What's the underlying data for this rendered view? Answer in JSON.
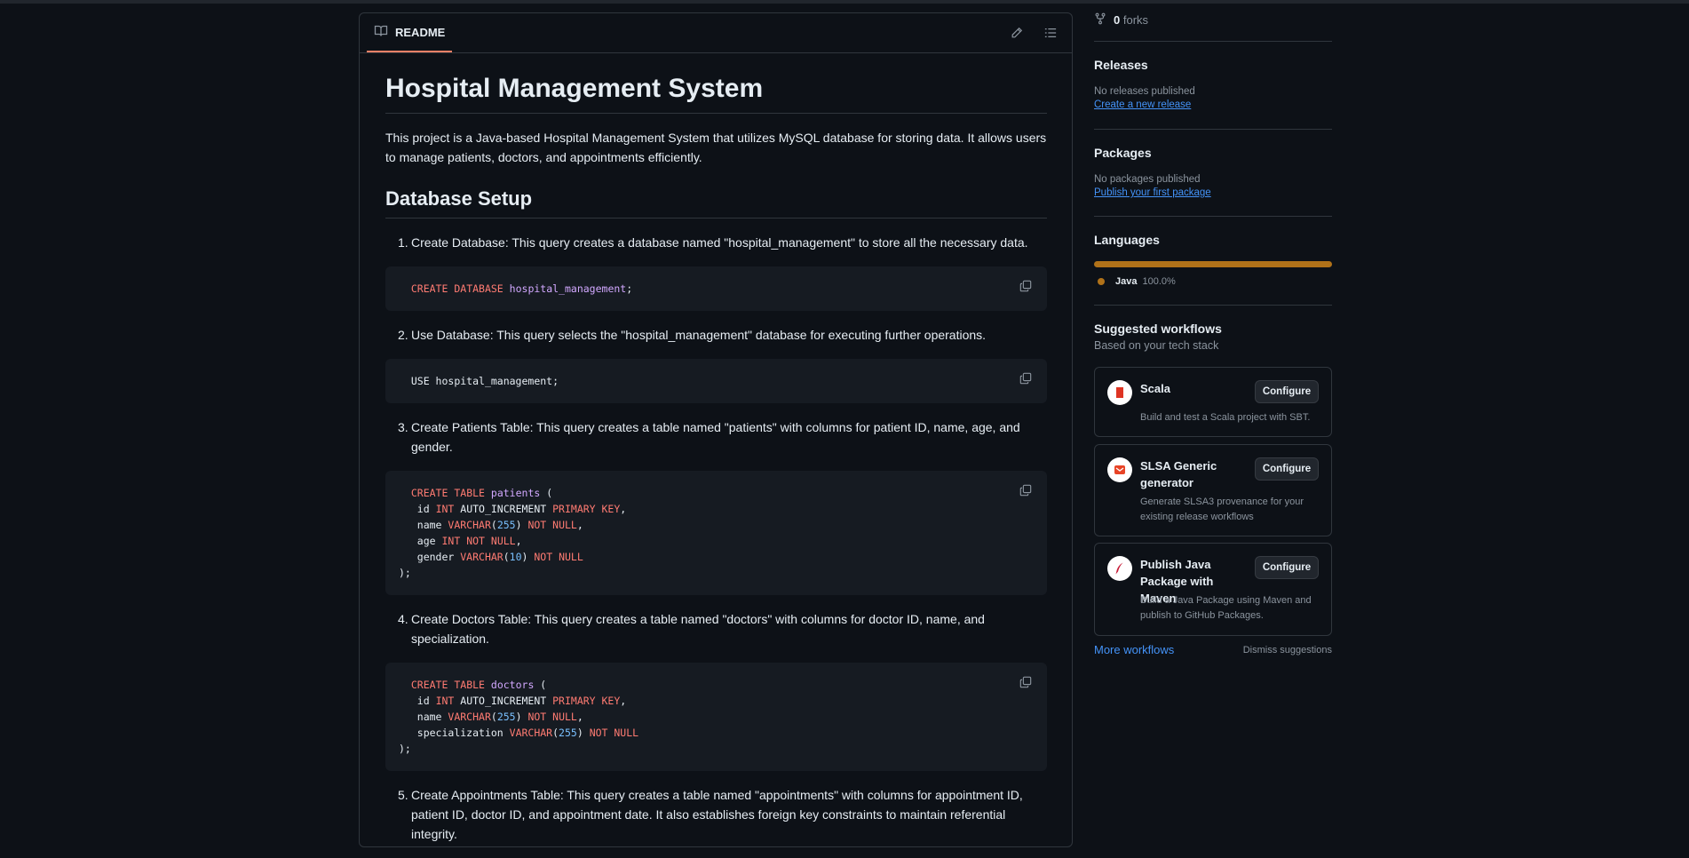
{
  "readme": {
    "tab_label": "README",
    "title": "Hospital Management System",
    "intro": "This project is a Java-based Hospital Management System that utilizes MySQL database for storing data. It allows users to manage patients, doctors, and appointments efficiently.",
    "section_heading": "Database Setup",
    "steps": [
      {
        "num": "1.",
        "text": "Create Database: This query creates a database named \"hospital_management\" to store all the necessary data."
      },
      {
        "num": "2.",
        "text": "Use Database: This query selects the \"hospital_management\" database for executing further operations."
      },
      {
        "num": "3.",
        "text": "Create Patients Table: This query creates a table named \"patients\" with columns for patient ID, name, age, and gender."
      },
      {
        "num": "4.",
        "text": "Create Doctors Table: This query creates a table named \"doctors\" with columns for doctor ID, name, and specialization."
      },
      {
        "num": "5.",
        "text": "Create Appointments Table: This query creates a table named \"appointments\" with columns for appointment ID, patient ID, doctor ID, and appointment date. It also establishes foreign key constraints to maintain referential integrity."
      }
    ],
    "code": {
      "create_db": [
        "CREATE",
        "DATABASE",
        "hospital_management",
        ";"
      ],
      "use_db": "USE hospital_management;",
      "patients": {
        "kw_create": "CREATE",
        "kw_table": "TABLE",
        "table": "patients",
        "open": " (",
        "l1_col": " id ",
        "l1_type": "INT",
        "l1_mid": " AUTO_INCREMENT ",
        "l1_kw": "PRIMARY KEY",
        "l1_end": ",",
        "l2_col": " name ",
        "l2_type": "VARCHAR",
        "l2_num": "255",
        "l2_kw": "NOT NULL",
        "l2_end": ",",
        "l3_col": " age ",
        "l3_type": "INT",
        "l3_kw": "NOT NULL",
        "l3_end": ",",
        "l4_col": " gender ",
        "l4_type": "VARCHAR",
        "l4_num": "10",
        "l4_kw": "NOT NULL",
        "close": ");"
      },
      "doctors": {
        "kw_create": "CREATE",
        "kw_table": "TABLE",
        "table": "doctors",
        "open": " (",
        "l1_col": " id ",
        "l1_type": "INT",
        "l1_mid": " AUTO_INCREMENT ",
        "l1_kw": "PRIMARY KEY",
        "l1_end": ",",
        "l2_col": " name ",
        "l2_type": "VARCHAR",
        "l2_num": "255",
        "l2_kw": "NOT NULL",
        "l2_end": ",",
        "l3_col": " specialization ",
        "l3_type": "VARCHAR",
        "l3_num": "255",
        "l3_kw": "NOT NULL",
        "close": ");"
      }
    }
  },
  "sidebar": {
    "forks_count": "0",
    "forks_label": "forks",
    "releases": {
      "heading": "Releases",
      "status": "No releases published",
      "link": "Create a new release"
    },
    "packages": {
      "heading": "Packages",
      "status": "No packages published",
      "link": "Publish your first package"
    },
    "languages": {
      "heading": "Languages",
      "items": [
        {
          "name": "Java",
          "percent": "100.0%",
          "fraction": 1.0,
          "color": "#b07219"
        }
      ]
    },
    "workflows": {
      "heading": "Suggested workflows",
      "subheading": "Based on your tech stack",
      "configure_label": "Configure",
      "items": [
        {
          "title": "Scala",
          "desc": "Build and test a Scala project with SBT.",
          "icon": "scala-icon"
        },
        {
          "title": "SLSA Generic generator",
          "desc": "Generate SLSA3 provenance for your existing release workflows",
          "icon": "slsa-icon"
        },
        {
          "title": "Publish Java Package with Maven",
          "desc": "Build a Java Package using Maven and publish to GitHub Packages.",
          "icon": "maven-icon"
        }
      ],
      "more_link": "More workflows",
      "dismiss_link": "Dismiss suggestions"
    }
  },
  "colors": {
    "accent_tab": "#f78166",
    "link": "#4493f8",
    "java": "#b07219",
    "keyword": "#ff7b72",
    "entity": "#d2a8ff",
    "number": "#79c0ff"
  }
}
